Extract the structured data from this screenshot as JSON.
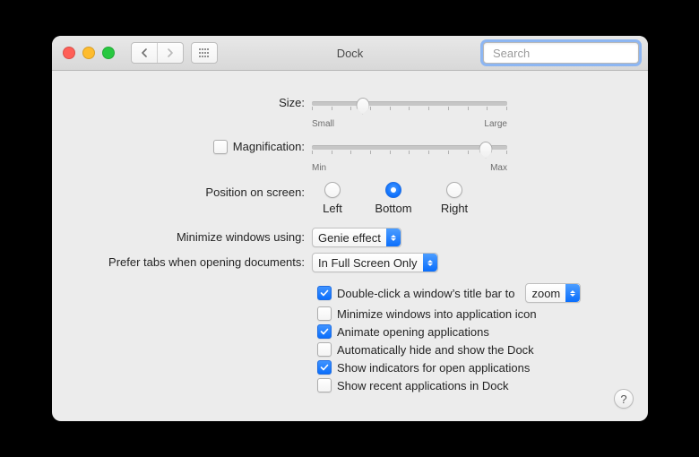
{
  "title": "Dock",
  "search": {
    "placeholder": "Search",
    "value": ""
  },
  "size": {
    "label": "Size:",
    "min_label": "Small",
    "max_label": "Large",
    "value_pct": 26
  },
  "magnification": {
    "enabled": false,
    "label": "Magnification:",
    "min_label": "Min",
    "max_label": "Max",
    "value_pct": 89
  },
  "position": {
    "label": "Position on screen:",
    "options": [
      "Left",
      "Bottom",
      "Right"
    ],
    "selected": "Bottom"
  },
  "minimize_using": {
    "label": "Minimize windows using:",
    "value": "Genie effect"
  },
  "prefer_tabs": {
    "label": "Prefer tabs when opening documents:",
    "value": "In Full Screen Only"
  },
  "double_click": {
    "enabled": true,
    "label": "Double-click a window’s title bar to",
    "value": "zoom"
  },
  "options": {
    "minimize_into_app_icon": {
      "label": "Minimize windows into application icon",
      "enabled": false
    },
    "animate_opening": {
      "label": "Animate opening applications",
      "enabled": true
    },
    "autohide": {
      "label": "Automatically hide and show the Dock",
      "enabled": false
    },
    "indicators": {
      "label": "Show indicators for open applications",
      "enabled": true
    },
    "recent_apps": {
      "label": "Show recent applications in Dock",
      "enabled": false
    }
  }
}
